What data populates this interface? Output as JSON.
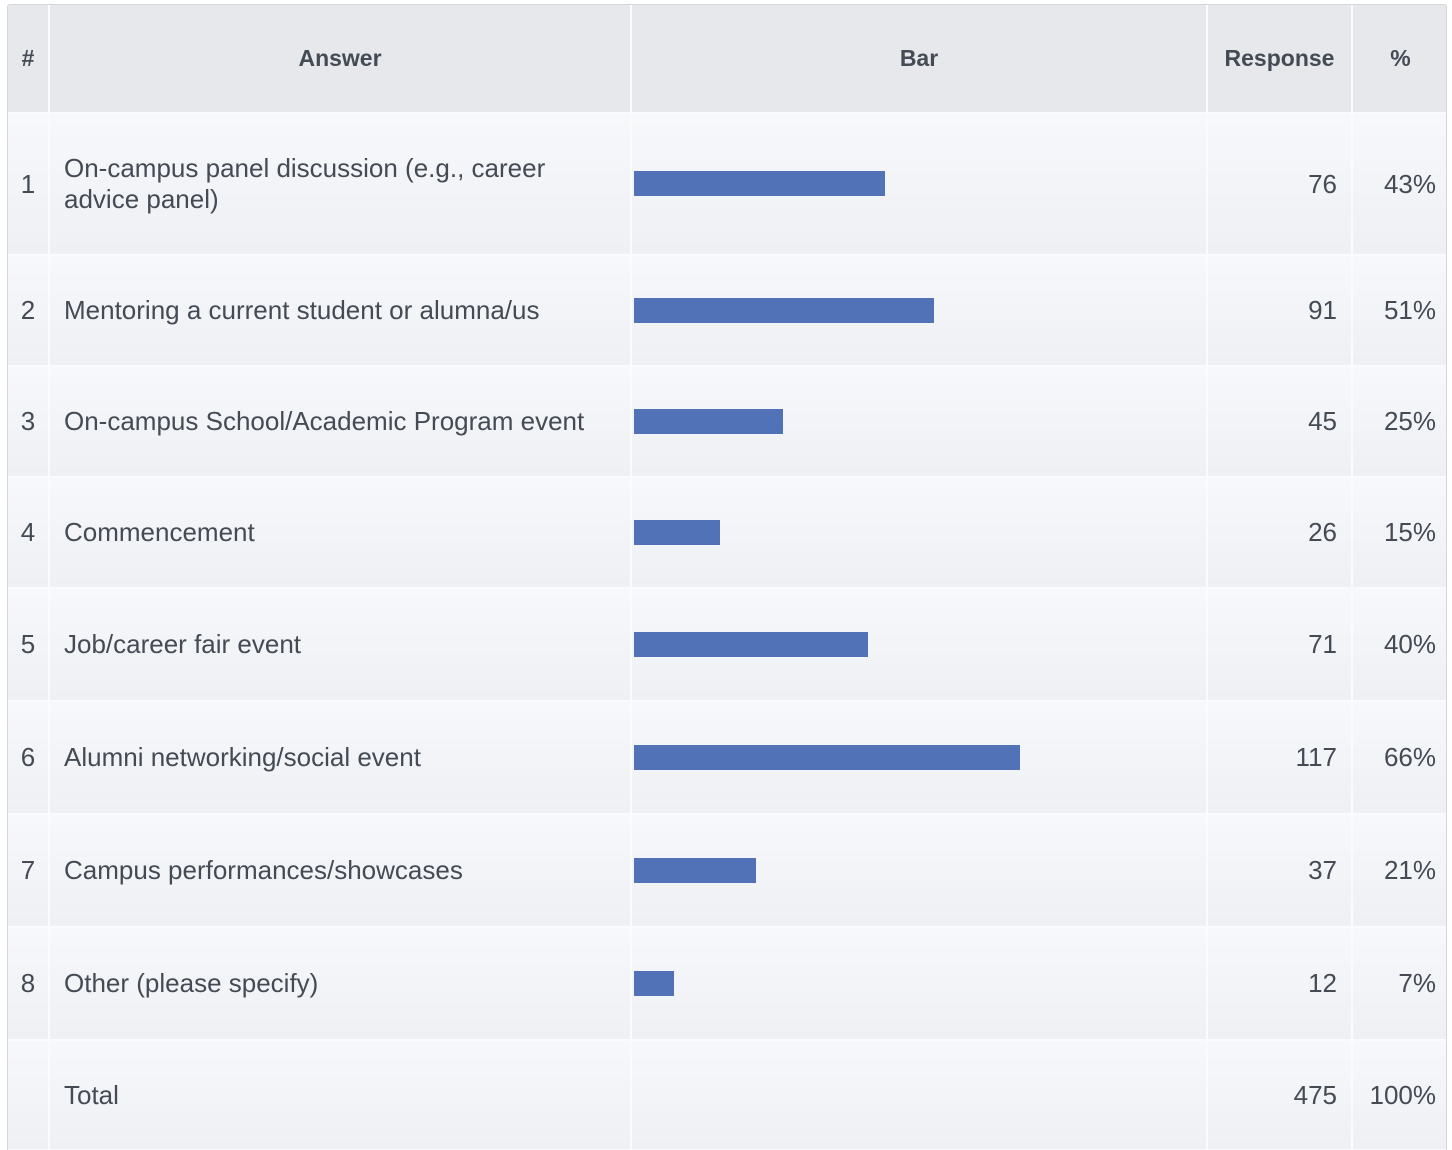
{
  "headers": {
    "num": "#",
    "answer": "Answer",
    "bar": "Bar",
    "response": "Response",
    "percent": "%"
  },
  "bar_color": "#5272b8",
  "chart_data": {
    "type": "bar",
    "orientation": "horizontal",
    "categories": [
      "On-campus panel discussion (e.g., career advice panel)",
      "Mentoring a current student or alumna/us",
      "On-campus School/Academic Program event",
      "Commencement",
      "Job/career fair event",
      "Alumni networking/social event",
      "Campus performances/showcases",
      "Other (please specify)"
    ],
    "values": [
      76,
      91,
      45,
      26,
      71,
      117,
      37,
      12
    ],
    "xlim": [
      0,
      180
    ]
  },
  "rows": [
    {
      "num": "1",
      "answer": "On-campus panel discussion (e.g., career advice panel)",
      "response": "76",
      "percent": "43%"
    },
    {
      "num": "2",
      "answer": "Mentoring a current student or alumna/us",
      "response": "91",
      "percent": "51%"
    },
    {
      "num": "3",
      "answer": "On-campus School/Academic Program event",
      "response": "45",
      "percent": "25%"
    },
    {
      "num": "4",
      "answer": "Commencement",
      "response": "26",
      "percent": "15%"
    },
    {
      "num": "5",
      "answer": "Job/career fair event",
      "response": "71",
      "percent": "40%"
    },
    {
      "num": "6",
      "answer": "Alumni networking/social event",
      "response": "117",
      "percent": "66%"
    },
    {
      "num": "7",
      "answer": "Campus performances/showcases",
      "response": "37",
      "percent": "21%"
    },
    {
      "num": "8",
      "answer": "Other (please specify)",
      "response": "12",
      "percent": "7%"
    }
  ],
  "total": {
    "label": "Total",
    "response": "475",
    "percent": "100%"
  }
}
